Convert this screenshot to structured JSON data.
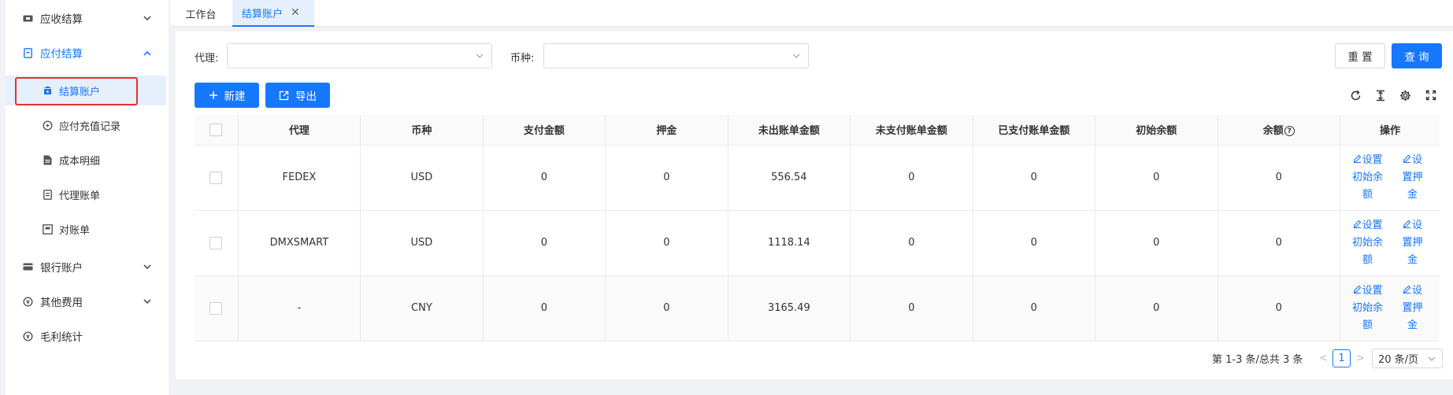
{
  "sidebar": {
    "groups": [
      {
        "label": "应收结算",
        "icon": "ticket-icon",
        "expanded": false
      },
      {
        "label": "应付结算",
        "icon": "receipt-icon",
        "expanded": true
      },
      {
        "label": "银行账户",
        "icon": "card-icon",
        "expanded": false
      },
      {
        "label": "其他费用",
        "icon": "coins-icon",
        "expanded": false
      },
      {
        "label": "毛利统计",
        "icon": "coins-icon",
        "expanded": false
      }
    ],
    "sub_items": [
      {
        "label": "结算账户",
        "icon": "bank-icon",
        "active": true
      },
      {
        "label": "应付充值记录",
        "icon": "recharge-icon",
        "active": false
      },
      {
        "label": "成本明细",
        "icon": "document-icon",
        "active": false
      },
      {
        "label": "代理账单",
        "icon": "bill-icon",
        "active": false
      },
      {
        "label": "对账单",
        "icon": "statement-icon",
        "active": false
      }
    ]
  },
  "tabs": {
    "home": "工作台",
    "current": "结算账户",
    "close_glyph": "✕"
  },
  "filters": {
    "agent_label": "代理:",
    "agent_value": "",
    "currency_label": "币种:",
    "currency_value": ""
  },
  "buttons": {
    "reset": "重 置",
    "search": "查 询",
    "new": "新建",
    "export": "导出"
  },
  "table": {
    "columns": [
      "代理",
      "币种",
      "支付金额",
      "押金",
      "未出账单金额",
      "未支付账单金额",
      "已支付账单金额",
      "初始余额",
      "余额",
      "操作"
    ],
    "rows": [
      {
        "agent": "FEDEX",
        "currency": "USD",
        "paid": "0",
        "deposit": "0",
        "unbilled": "556.54",
        "unpaid": "0",
        "paid_bill": "0",
        "initial": "0",
        "balance": "0"
      },
      {
        "agent": "DMXSMART",
        "currency": "USD",
        "paid": "0",
        "deposit": "0",
        "unbilled": "1118.14",
        "unpaid": "0",
        "paid_bill": "0",
        "initial": "0",
        "balance": "0"
      },
      {
        "agent": "-",
        "currency": "CNY",
        "paid": "0",
        "deposit": "0",
        "unbilled": "3165.49",
        "unpaid": "0",
        "paid_bill": "0",
        "initial": "0",
        "balance": "0"
      }
    ],
    "actions": {
      "set_initial": [
        "设置",
        "初始余",
        "额"
      ],
      "set_deposit": [
        "设",
        "置押",
        "金"
      ]
    },
    "help_glyph": "?"
  },
  "pagination": {
    "total_text": "第 1-3 条/总共 3 条",
    "current_page": "1",
    "page_size": "20 条/页",
    "prev_glyph": "<",
    "next_glyph": ">"
  },
  "colors": {
    "primary": "#1677ff",
    "highlight": "#e5322d"
  }
}
